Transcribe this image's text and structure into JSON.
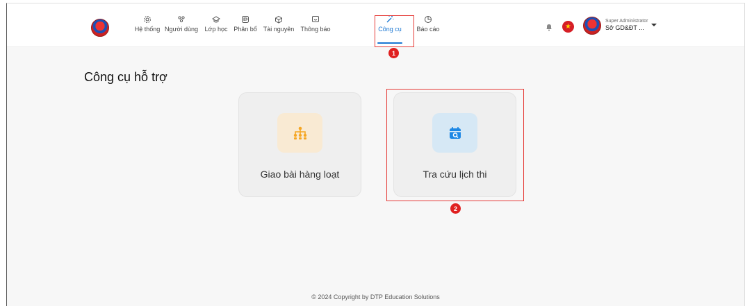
{
  "nav": {
    "items": [
      {
        "label": "Hệ thống",
        "icon": "gear-icon"
      },
      {
        "label": "Người dùng",
        "icon": "users-icon"
      },
      {
        "label": "Lớp học",
        "icon": "graduation-cap-icon"
      },
      {
        "label": "Phân bổ",
        "icon": "distribute-icon"
      },
      {
        "label": "Tài nguyên",
        "icon": "cube-icon"
      },
      {
        "label": "Thông báo",
        "icon": "message-icon"
      },
      {
        "label": "Công cụ",
        "icon": "magic-wand-icon"
      },
      {
        "label": "Báo cáo",
        "icon": "pie-chart-icon"
      }
    ],
    "active": "Công cụ",
    "accent_color": "#1976d2"
  },
  "user": {
    "role": "Super Administrator",
    "name": "Sở GD&ĐT ..."
  },
  "annotations": {
    "marker1": "1",
    "marker2": "2",
    "color": "#e53935"
  },
  "page": {
    "title": "Công cụ hỗ trợ"
  },
  "cards": [
    {
      "label": "Giao bài hàng loạt",
      "icon": "hierarchy-icon",
      "icon_bg": "#f9ead3",
      "icon_color": "#f5a623"
    },
    {
      "label": "Tra cứu lịch thi",
      "icon": "calendar-search-icon",
      "icon_bg": "#d6e8f5",
      "icon_color": "#1e88e5"
    }
  ],
  "footer": {
    "text": "© 2024 Copyright by DTP Education Solutions"
  }
}
